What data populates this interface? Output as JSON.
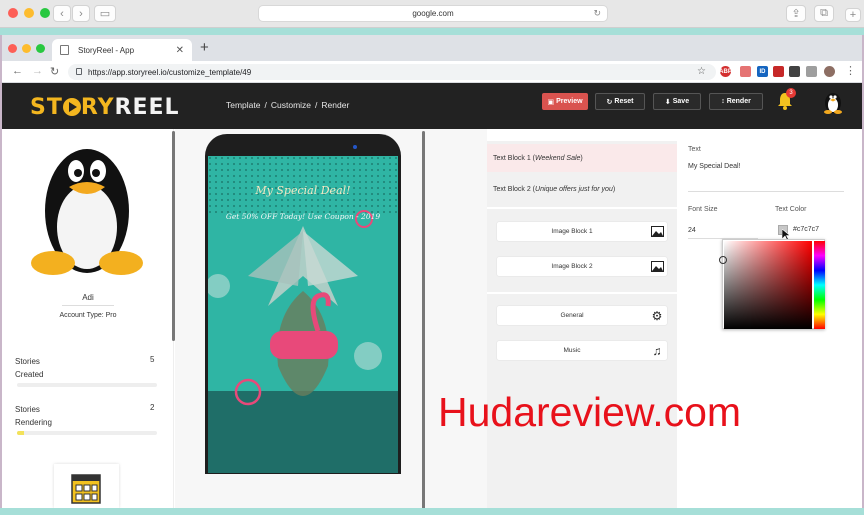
{
  "safari": {
    "address": "google.com"
  },
  "browser": {
    "tab_title": "StoryReel - App",
    "tab_close": "✕",
    "new_tab": "+",
    "url": "https://app.storyreel.io/customize_template/49",
    "ext_labels": [
      "ABP",
      "ID"
    ]
  },
  "header": {
    "logo_a": "ST",
    "logo_b": "RY",
    "logo_c": "REEL",
    "breadcrumb": [
      "Template",
      "/",
      "Customize",
      "/",
      "Render"
    ],
    "buttons": {
      "preview": "Preview",
      "reset": "Reset",
      "save": "Save",
      "render": "Render"
    },
    "notification_count": "3"
  },
  "profile": {
    "name": "Adi",
    "account_type": "Account Type: Pro",
    "stats": [
      {
        "label": "Stories\nCreated",
        "value": "5",
        "progress": 0
      },
      {
        "label": "Stories\nRendering",
        "value": "2",
        "progress": 0.05
      }
    ]
  },
  "preview": {
    "headline": "My Special Deal!",
    "subline": "Get 50% OFF Today! Use Coupon - 2019",
    "colors": {
      "bg": "#2fb5a4",
      "accent": "#e8497a"
    }
  },
  "blocks": {
    "text_blocks": [
      {
        "prefix": "Text Block 1 (",
        "name": "Weekend Sale",
        "suffix": " )"
      },
      {
        "prefix": "Text Block 2 (",
        "name": "Unique offers just for you",
        "suffix": ")"
      }
    ],
    "image_blocks": [
      "Image Block 1",
      "Image Block 2"
    ],
    "general": "General",
    "music": "Music"
  },
  "editor": {
    "text_label": "Text",
    "text_value": "My Special Deal!",
    "font_size_label": "Font Size",
    "font_size_value": "24",
    "text_color_label": "Text Color",
    "text_color_value": "#c7c7c7"
  },
  "watermark": "Hudareview.com"
}
